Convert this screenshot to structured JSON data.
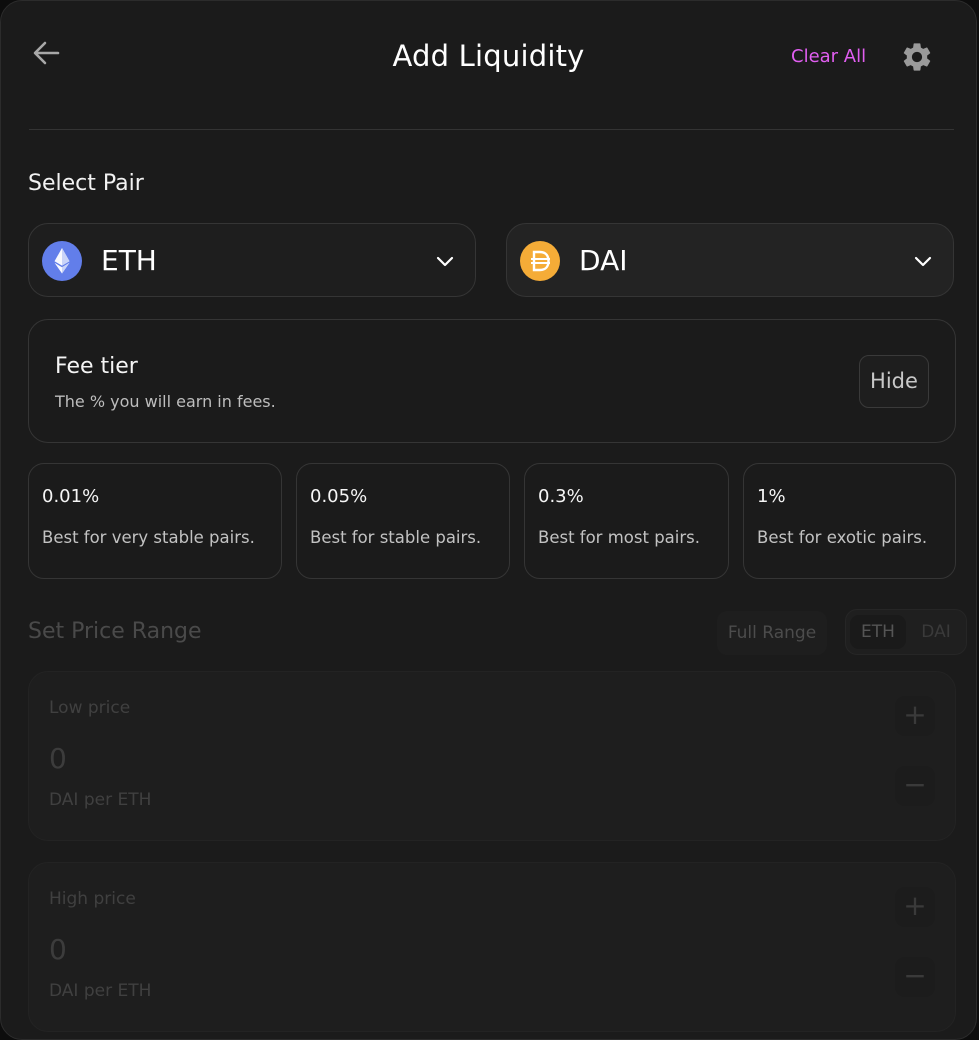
{
  "header": {
    "title": "Add Liquidity",
    "clear_all_label": "Clear All"
  },
  "pair": {
    "section_label": "Select Pair",
    "token_a": {
      "symbol": "ETH",
      "icon": "eth-logo-icon"
    },
    "token_b": {
      "symbol": "DAI",
      "icon": "dai-logo-icon"
    }
  },
  "fee_tier": {
    "title": "Fee tier",
    "subtitle": "The % you will earn in fees.",
    "hide_label": "Hide",
    "options": [
      {
        "percent": "0.01%",
        "description": "Best for very stable pairs."
      },
      {
        "percent": "0.05%",
        "description": "Best for stable pairs."
      },
      {
        "percent": "0.3%",
        "description": "Best for most pairs."
      },
      {
        "percent": "1%",
        "description": "Best for exotic pairs."
      }
    ]
  },
  "price_range": {
    "section_label": "Set Price Range",
    "full_range_label": "Full Range",
    "toggle": [
      "ETH",
      "DAI"
    ],
    "low": {
      "label": "Low price",
      "value": "0",
      "unit": "DAI per ETH"
    },
    "high": {
      "label": "High price",
      "value": "0",
      "unit": "DAI per ETH"
    },
    "increment_symbol": "+",
    "decrement_symbol": "−"
  },
  "colors": {
    "accent": "#e05ef0",
    "eth_logo": "#627eea",
    "dai_logo": "#f5ac37"
  }
}
